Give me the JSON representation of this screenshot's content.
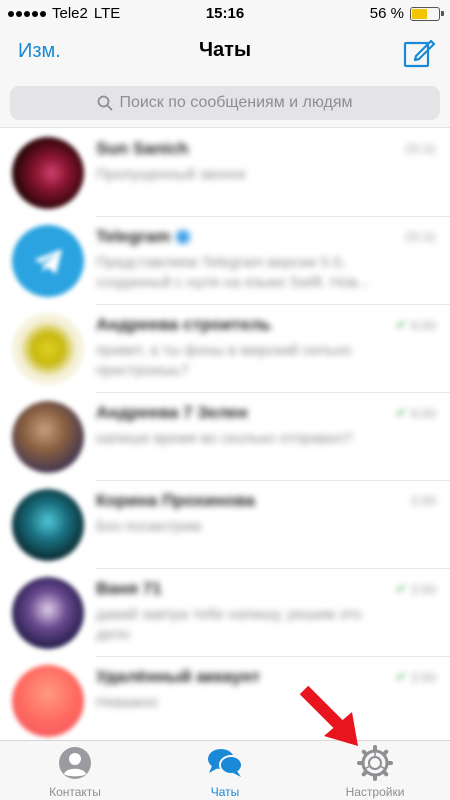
{
  "status_bar": {
    "carrier": "Tele2",
    "network": "LTE",
    "time": "15:16",
    "battery_text": "56 %",
    "battery_level": 0.56,
    "battery_color": "#f5c400"
  },
  "nav": {
    "edit_label": "Изм.",
    "title": "Чаты",
    "compose_icon": "compose-icon"
  },
  "search": {
    "placeholder": "Поиск по сообщениям и людям"
  },
  "chats": [
    {
      "name": "Sun Sanich",
      "time": "15:11",
      "preview": "Пропущенный звонок",
      "read_check": ""
    },
    {
      "name": "Telegram",
      "time": "15:11",
      "preview": "Представляем Telegram версии 5.0, созданный с нуля на языке Swift. Нов...",
      "read_check": ""
    },
    {
      "name": "Андреева строитель",
      "time": "6:00",
      "preview": "привет, а ты фоны в мирский сильно пристроишь?",
      "read_check": "✔"
    },
    {
      "name": "Андреева 7 Зелен",
      "time": "6:00",
      "preview": "напиши время во сколько отправил?",
      "read_check": "✔"
    },
    {
      "name": "Корина Прохинова",
      "time": "2:00",
      "preview": "Без посмотрим",
      "read_check": ""
    },
    {
      "name": "Ваня 71",
      "time": "2:00",
      "preview": "давай завтра тебе напишу, решим это дело",
      "read_check": "✔"
    },
    {
      "name": "Удалённый аккаунт",
      "time": "2:00",
      "preview": "Неважно",
      "read_check": "✔"
    }
  ],
  "tabs": [
    {
      "label": "Контакты",
      "icon": "person-icon",
      "active": false
    },
    {
      "label": "Чаты",
      "icon": "chat-bubbles-icon",
      "active": true
    },
    {
      "label": "Настройки",
      "icon": "gear-icon",
      "active": false
    }
  ],
  "colors": {
    "accent": "#1a8ad8",
    "annotation_arrow": "#e8141e"
  }
}
